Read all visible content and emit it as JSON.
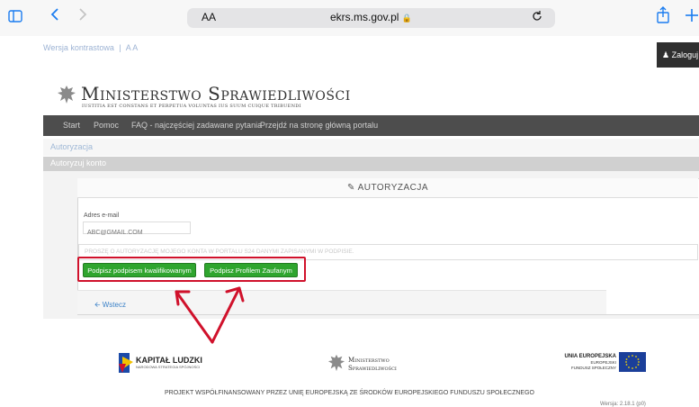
{
  "browser": {
    "aa_label": "AA",
    "url": "ekrs.ms.gov.pl",
    "lock_glyph": "🔒"
  },
  "topbar": {
    "contrast_link": "Wersja kontrastowa",
    "separator": "|",
    "font_size_link": "A A",
    "login_label": "Zaloguj"
  },
  "brand": {
    "title": "Ministerstwo Sprawiedliwości",
    "motto": "IUSTITIA EST CONSTANS ET PERPETUA VOLUNTAS IUS SUUM CUIQUE TRIBUENDI"
  },
  "nav": {
    "items": [
      "Start",
      "Pomoc",
      "FAQ - najczęściej zadawane pytania",
      "Przejdź na stronę główną portalu"
    ]
  },
  "breadcrumb": "Autoryzacja",
  "section_bar": "Autoryzuj konto",
  "panel": {
    "title": "AUTORYZACJA",
    "email_label": "Adres e-mail",
    "email_placeholder": "ABC@GMAIL.COM",
    "statement": "PROSZĘ O AUTORYZACJĘ MOJEGO KONTA W PORTALU S24 DANYMI ZAPISANYMI W PODPISIE.",
    "button_qualified": "Podpisz podpisem kwalifikowanym",
    "button_trusted": "Podpisz Profilem Zaufanym",
    "back_label": "Wstecz"
  },
  "logos": {
    "kl_title": "KAPITAŁ LUDZKI",
    "kl_sub": "NARODOWA STRATEGIA SPÓJNOŚCI",
    "ms_line1": "Ministerstwo",
    "ms_line2": "Sprawiedliwości",
    "ue_line1": "UNIA EUROPEJSKA",
    "ue_line2": "EUROPEJSKI",
    "ue_line3": "FUNDUSZ SPOŁECZNY"
  },
  "footer": "PROJEKT WSPÓŁFINANSOWANY PRZEZ UNIĘ EUROPEJSKĄ ZE ŚRODKÓW EUROPEJSKIEGO FUNDUSZU SPOŁECZNEGO",
  "version": "Wersja: 2.18.1 (p0)",
  "colors": {
    "accent_blue": "#1a7cf0",
    "button_green": "#2fa52e",
    "highlight_red": "#d0112b",
    "nav_bg": "#4d4d4d"
  }
}
